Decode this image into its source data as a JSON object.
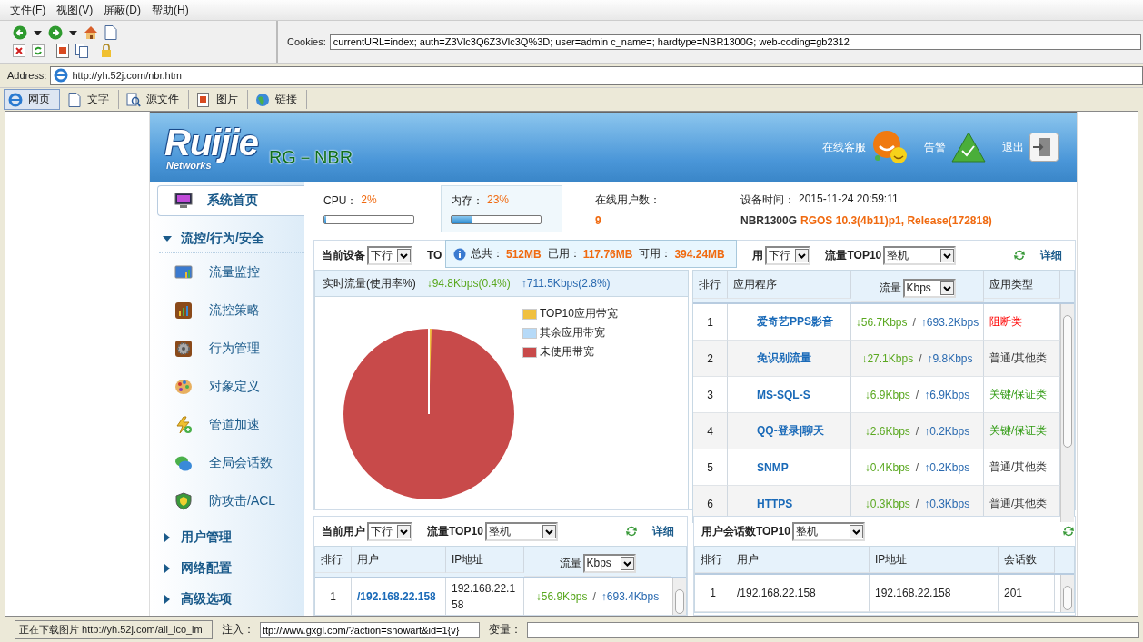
{
  "menu_bar": [
    "文件(F)",
    "视图(V)",
    "屏蔽(D)",
    "帮助(H)"
  ],
  "cookies": {
    "label": "Cookies:",
    "value": "currentURL=index; auth=Z3Vlc3Q6Z3Vlc3Q%3D; user=admin c_name=; hardtype=NBR1300G; web-coding=gb2312"
  },
  "address": {
    "label": "Address:",
    "value": "http://yh.52j.com/nbr.htm"
  },
  "view_tabs": [
    {
      "label": "网页",
      "selected": true,
      "kind": "page"
    },
    {
      "label": "文字",
      "selected": false,
      "kind": "text"
    },
    {
      "label": "源文件",
      "selected": false,
      "kind": "source"
    },
    {
      "label": "图片",
      "selected": false,
      "kind": "image"
    },
    {
      "label": "链接",
      "selected": false,
      "kind": "link"
    }
  ],
  "header": {
    "logo": "Ruijie",
    "logo_sub": "Networks",
    "product": "RG－NBR",
    "actions": [
      {
        "label": "在线客服",
        "kind": "support"
      },
      {
        "label": "告警",
        "kind": "alarm"
      },
      {
        "label": "退出",
        "kind": "exit"
      }
    ]
  },
  "sidebar": {
    "home": {
      "label": "系统首页",
      "selected": true
    },
    "sections": [
      {
        "label": "流控/行为/安全",
        "expanded": true,
        "children": [
          {
            "label": "流量监控",
            "kind": "monitor",
            "selected": false
          },
          {
            "label": "流控策略",
            "kind": "chart",
            "selected": false
          },
          {
            "label": "行为管理",
            "kind": "gear",
            "selected": false
          },
          {
            "label": "对象定义",
            "kind": "palette",
            "selected": false
          },
          {
            "label": "管道加速",
            "kind": "bolt",
            "selected": false
          },
          {
            "label": "全局会话数",
            "kind": "chat",
            "selected": false
          },
          {
            "label": "防攻击/ACL",
            "kind": "shield",
            "selected": false
          }
        ]
      },
      {
        "label": "用户管理",
        "expanded": false
      },
      {
        "label": "网络配置",
        "expanded": false
      },
      {
        "label": "高级选项",
        "expanded": false
      }
    ]
  },
  "stats": {
    "cpu": {
      "label": "CPU：",
      "value": "2%",
      "level": 0.02,
      "selected": false
    },
    "memory": {
      "label": "内存：",
      "value": "23%",
      "level": 0.23,
      "selected": true
    },
    "online": {
      "label": "在线用户数：",
      "value": "9"
    },
    "device": {
      "label": "设备时间：",
      "time": "2015-11-24 20:59:11",
      "model": "NBR1300G",
      "version": "RGOS 10.3(4b11)p1, Release(172818)"
    }
  },
  "memory_tooltip": [
    {
      "label": "总共：",
      "value": "512MB"
    },
    {
      "label": "已用：",
      "value": "117.76MB"
    },
    {
      "label": "可用：",
      "value": "394.24MB"
    }
  ],
  "top_panel": {
    "device_label": "当前设备",
    "device_select": "下行",
    "covered_left": "TO",
    "covered_right": "用",
    "app_select": "下行",
    "flow_label": "流量TOP10",
    "scope_select": "整机",
    "detail_link": "详细",
    "realtime": {
      "label": "实时流量(使用率%)",
      "down": "↓94.8Kbps(0.4%)",
      "up": "↑711.5Kbps(2.8%)"
    },
    "legend": [
      {
        "label": "TOP10应用带宽",
        "color": "#f0c040"
      },
      {
        "label": "其余应用带宽",
        "color": "#b6daf8"
      },
      {
        "label": "未使用带宽",
        "color": "#c84a4a"
      }
    ],
    "app_table": {
      "columns": [
        "排行",
        "应用程序",
        "流量",
        "应用类型"
      ],
      "unit_select": "Kbps",
      "separator": "/",
      "rows": [
        {
          "rank": "1",
          "app": "爱奇艺PPS影音",
          "down": "↓56.7Kbps",
          "up": "↑693.2Kbps",
          "type": "阻断类",
          "kind": "blocked"
        },
        {
          "rank": "2",
          "app": "免识别流量",
          "down": "↓27.1Kbps",
          "up": "↑9.8Kbps",
          "type": "普通/其他类",
          "kind": "normal"
        },
        {
          "rank": "3",
          "app": "MS-SQL-S",
          "down": "↓6.9Kbps",
          "up": "↑6.9Kbps",
          "type": "关键/保证类",
          "kind": "critical"
        },
        {
          "rank": "4",
          "app": "QQ-登录|聊天",
          "down": "↓2.6Kbps",
          "up": "↑0.2Kbps",
          "type": "关键/保证类",
          "kind": "critical"
        },
        {
          "rank": "5",
          "app": "SNMP",
          "down": "↓0.4Kbps",
          "up": "↑0.2Kbps",
          "type": "普通/其他类",
          "kind": "normal"
        },
        {
          "rank": "6",
          "app": "HTTPS",
          "down": "↓0.3Kbps",
          "up": "↑0.3Kbps",
          "type": "普通/其他类",
          "kind": "normal"
        }
      ]
    }
  },
  "user_panel": {
    "label": "当前用户",
    "direction_select": "下行",
    "flow_label": "流量TOP10",
    "scope_select": "整机",
    "detail_link": "详细",
    "columns": [
      "排行",
      "用户",
      "IP地址",
      "流量"
    ],
    "unit_select": "Kbps",
    "separator": "/",
    "rows": [
      {
        "rank": "1",
        "user": "/192.168.22.158",
        "ip": "192.168.22.158",
        "down": "↓56.9Kbps",
        "up": "↑693.4Kbps"
      }
    ]
  },
  "session_panel": {
    "label": "用户会话数TOP10",
    "scope_select": "整机",
    "columns": [
      "排行",
      "用户",
      "IP地址",
      "会话数"
    ],
    "rows": [
      {
        "rank": "1",
        "user": "/192.168.22.158",
        "ip": "192.168.22.158",
        "sessions": "201"
      }
    ]
  },
  "status_bar": {
    "download": "正在下载图片 http://yh.52j.com/all_ico_im",
    "inject_label": "注入：",
    "inject_value": "ttp://www.gxgl.com/?action=showart&id=1{v}",
    "var_label": "变量："
  }
}
